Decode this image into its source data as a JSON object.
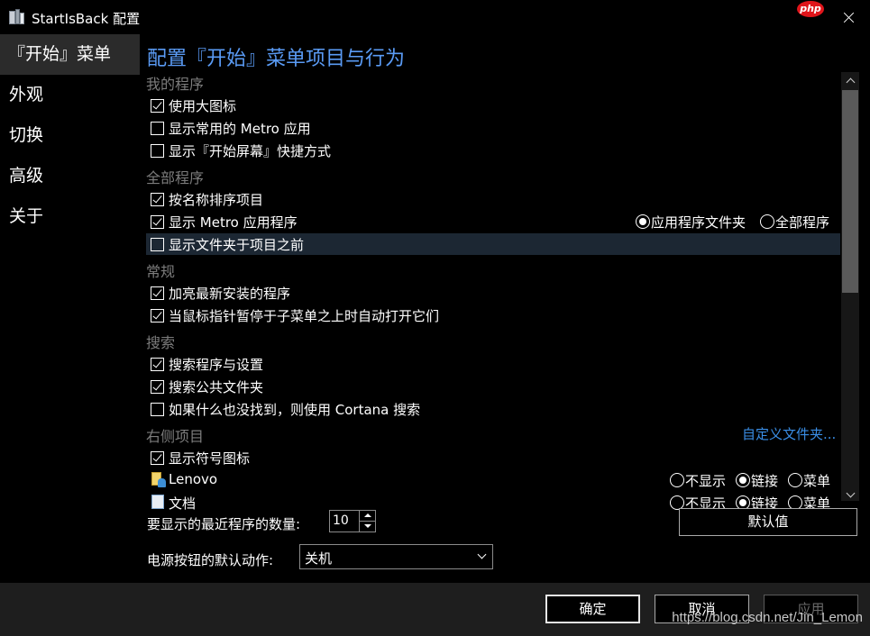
{
  "window": {
    "title": "StartIsBack 配置",
    "badge": "php"
  },
  "sidebar": {
    "items": [
      {
        "label": "『开始』菜单"
      },
      {
        "label": "外观"
      },
      {
        "label": "切换"
      },
      {
        "label": "高级"
      },
      {
        "label": "关于"
      }
    ]
  },
  "main": {
    "title": "配置『开始』菜单项目与行为",
    "sections": {
      "my_programs": "我的程序",
      "all_programs": "全部程序",
      "general": "常规",
      "search": "搜索",
      "right_items": "右侧项目"
    },
    "options": {
      "large_icons": {
        "label": "使用大图标",
        "checked": true
      },
      "frequent_metro": {
        "label": "显示常用的 Metro 应用",
        "checked": false
      },
      "start_screen_shortcut": {
        "label": "显示『开始屏幕』快捷方式",
        "checked": false
      },
      "sort_by_name": {
        "label": "按名称排序项目",
        "checked": true
      },
      "show_metro_apps": {
        "label": "显示 Metro 应用程序",
        "checked": true
      },
      "folders_first": {
        "label": "显示文件夹于项目之前",
        "checked": false
      },
      "highlight_new": {
        "label": "加亮最新安装的程序",
        "checked": true
      },
      "auto_open_submenu": {
        "label": "当鼠标指针暂停于子菜单之上时自动打开它们",
        "checked": true
      },
      "search_programs": {
        "label": "搜索程序与设置",
        "checked": true
      },
      "search_public": {
        "label": "搜索公共文件夹",
        "checked": true
      },
      "cortana_fallback": {
        "label": "如果什么也没找到，则使用 Cortana 搜索",
        "checked": false
      },
      "show_symbol_icons": {
        "label": "显示符号图标",
        "checked": true
      }
    },
    "metro_location": {
      "options": [
        "应用程序文件夹",
        "全部程序"
      ],
      "selected": "应用程序文件夹"
    },
    "customize_link": "自定义文件夹...",
    "right_items": [
      {
        "name": "Lenovo",
        "icon": "user-folder-icon",
        "options": [
          "不显示",
          "链接",
          "菜单"
        ],
        "selected": "链接"
      },
      {
        "name": "文档",
        "icon": "documents-icon",
        "options": [
          "不显示",
          "链接",
          "菜单"
        ],
        "selected": "链接"
      }
    ],
    "recent_count": {
      "label": "要显示的最近程序的数量:",
      "value": "10"
    },
    "power_action": {
      "label": "电源按钮的默认动作:",
      "value": "关机"
    },
    "default_button": "默认值"
  },
  "footer": {
    "ok": "确定",
    "cancel": "取消",
    "apply": "应用",
    "watermark": "https://blog.csdn.net/Jin_Lemon"
  }
}
